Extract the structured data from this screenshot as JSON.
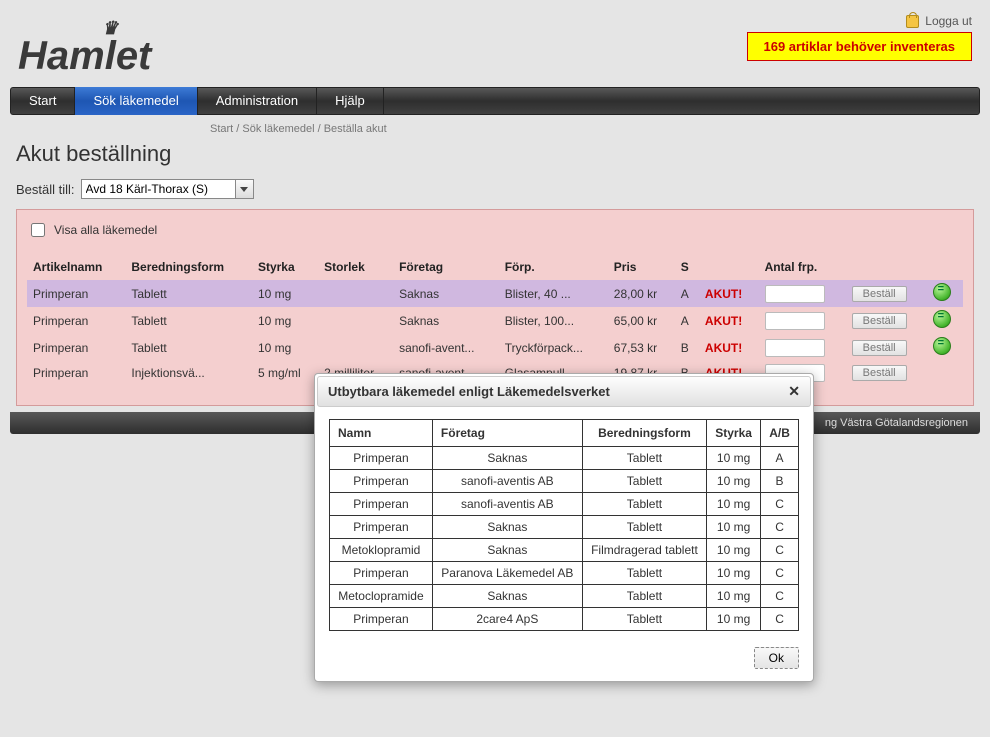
{
  "logout": "Logga ut",
  "logo_text": "Hamlet",
  "inventory_notice": "169 artiklar behöver inventeras",
  "nav": {
    "items": [
      "Start",
      "Sök läkemedel",
      "Administration",
      "Hjälp"
    ],
    "active_index": 1
  },
  "breadcrumb": "Start / Sök läkemedel / Beställa akut",
  "page_title": "Akut beställning",
  "dest_label": "Beställ till:",
  "dest_selected": "Avd 18 Kärl-Thorax (S)",
  "show_all_label": "Visa alla läkemedel",
  "show_all_checked": false,
  "orders": {
    "headers": [
      "Artikelnamn",
      "Beredningsform",
      "Styrka",
      "Storlek",
      "Företag",
      "Förp.",
      "Pris",
      "S",
      "",
      "Antal frp.",
      "",
      ""
    ],
    "rows": [
      {
        "sel": true,
        "name": "Primperan",
        "form": "Tablett",
        "styrka": "10 mg",
        "storlek": "",
        "foretag": "Saknas",
        "forp": "Blister, 40 ...",
        "pris": "28,00 kr",
        "s": "A",
        "akut": "AKUT!",
        "btn": "Beställ",
        "dot": true
      },
      {
        "sel": false,
        "name": "Primperan",
        "form": "Tablett",
        "styrka": "10 mg",
        "storlek": "",
        "foretag": "Saknas",
        "forp": "Blister, 100...",
        "pris": "65,00 kr",
        "s": "A",
        "akut": "AKUT!",
        "btn": "Beställ",
        "dot": true
      },
      {
        "sel": false,
        "name": "Primperan",
        "form": "Tablett",
        "styrka": "10 mg",
        "storlek": "",
        "foretag": "sanofi-avent...",
        "forp": "Tryckförpack...",
        "pris": "67,53 kr",
        "s": "B",
        "akut": "AKUT!",
        "btn": "Beställ",
        "dot": true
      },
      {
        "sel": false,
        "name": "Primperan",
        "form": "Injektionsvä...",
        "styrka": "5 mg/ml",
        "storlek": "2 milliliter",
        "foretag": "sanofi-avent...",
        "forp": "Glasampull, ...",
        "pris": "19,87 kr",
        "s": "B",
        "akut": "AKUT!",
        "btn": "Beställ",
        "dot": false
      }
    ]
  },
  "footer": "ng Västra Götalandsregionen",
  "dialog": {
    "title": "Utbytbara läkemedel enligt Läkemedelsverket",
    "headers": [
      "Namn",
      "Företag",
      "Beredningsform",
      "Styrka",
      "A/B"
    ],
    "rows": [
      [
        "Primperan",
        "Saknas",
        "Tablett",
        "10 mg",
        "A"
      ],
      [
        "Primperan",
        "sanofi-aventis AB",
        "Tablett",
        "10 mg",
        "B"
      ],
      [
        "Primperan",
        "sanofi-aventis AB",
        "Tablett",
        "10 mg",
        "C"
      ],
      [
        "Primperan",
        "Saknas",
        "Tablett",
        "10 mg",
        "C"
      ],
      [
        "Metoklopramid",
        "Saknas",
        "Filmdragerad tablett",
        "10 mg",
        "C"
      ],
      [
        "Primperan",
        "Paranova Läkemedel AB",
        "Tablett",
        "10 mg",
        "C"
      ],
      [
        "Metoclopramide",
        "Saknas",
        "Tablett",
        "10 mg",
        "C"
      ],
      [
        "Primperan",
        "2care4 ApS",
        "Tablett",
        "10 mg",
        "C"
      ]
    ],
    "ok": "Ok"
  }
}
